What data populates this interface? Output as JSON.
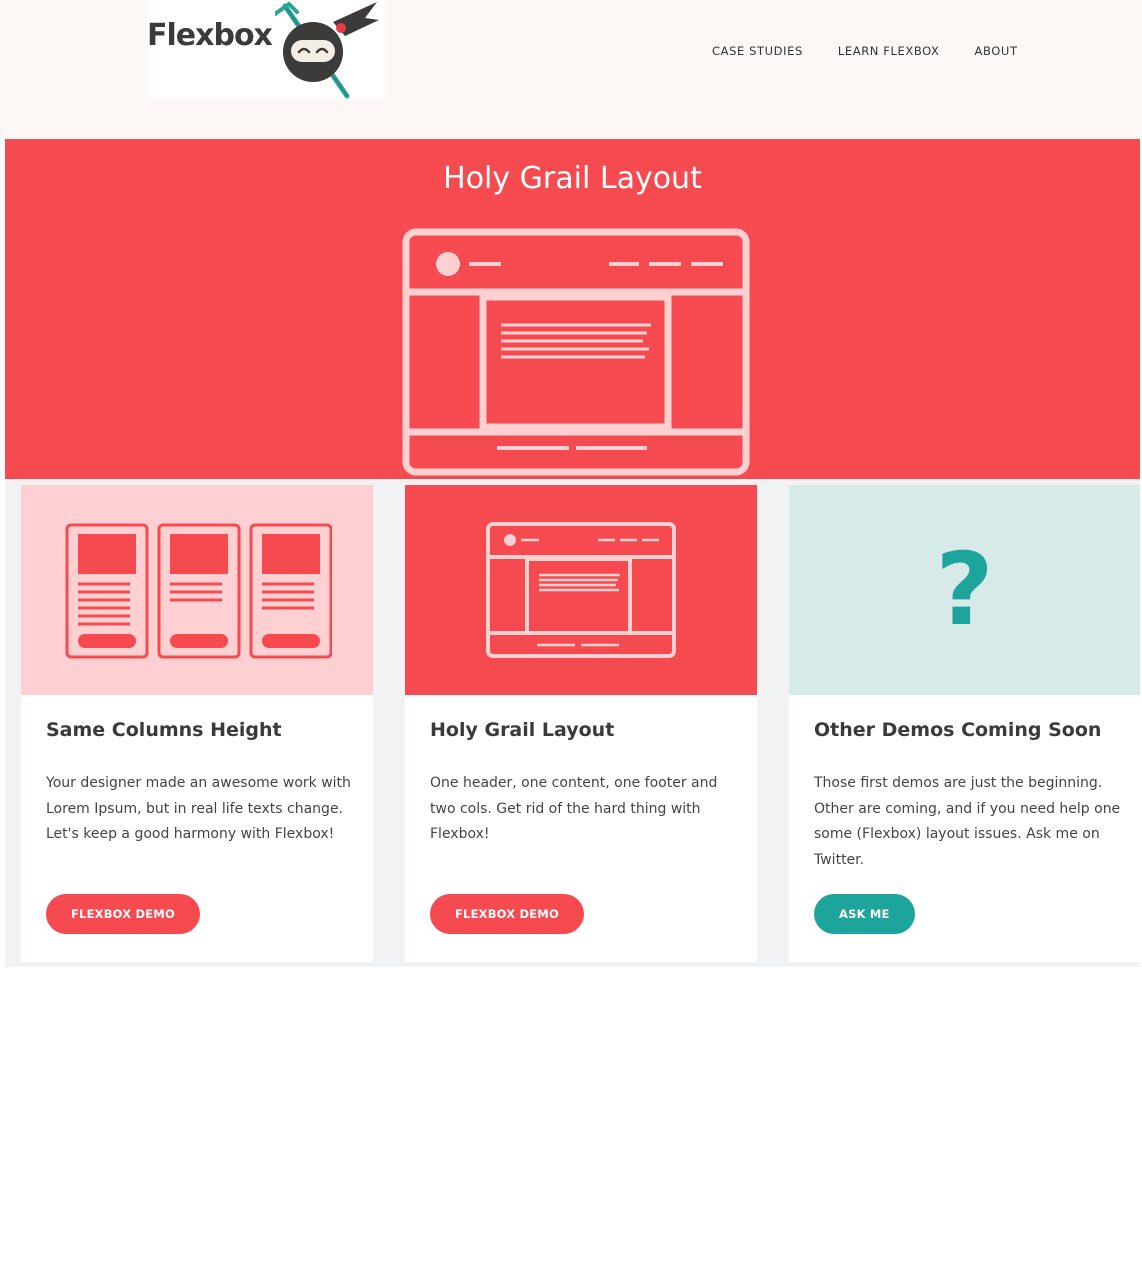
{
  "header": {
    "logo_text": "Flexbox",
    "nav": [
      "CASE STUDIES",
      "LEARN FLEXBOX",
      "ABOUT"
    ]
  },
  "hero": {
    "title": "Holy Grail Layout"
  },
  "cards": [
    {
      "title": "Same Columns Height",
      "text": "Your designer made an awesome work with Lorem Ipsum, but in real life texts change. Let's keep a good harmony with Flexbox!",
      "button": "FLEXBOX DEMO"
    },
    {
      "title": "Holy Grail Layout",
      "text": "One header, one content, one footer and two cols. Get rid of the hard thing with Flexbox!",
      "button": "FLEXBOX DEMO"
    },
    {
      "title": "Other Demos Coming Soon",
      "text": "Those first demos are just the beginning. Other are coming, and if you need help one some (Flexbox) layout issues. Ask me on Twitter.",
      "button": "ASK ME",
      "icon_glyph": "?"
    }
  ],
  "colors": {
    "primary": "#f54a50",
    "teal": "#1ea59b",
    "pink_bg": "#ffd0d2",
    "mint_bg": "#d7eaea",
    "header_bg": "#fdf8f6"
  }
}
